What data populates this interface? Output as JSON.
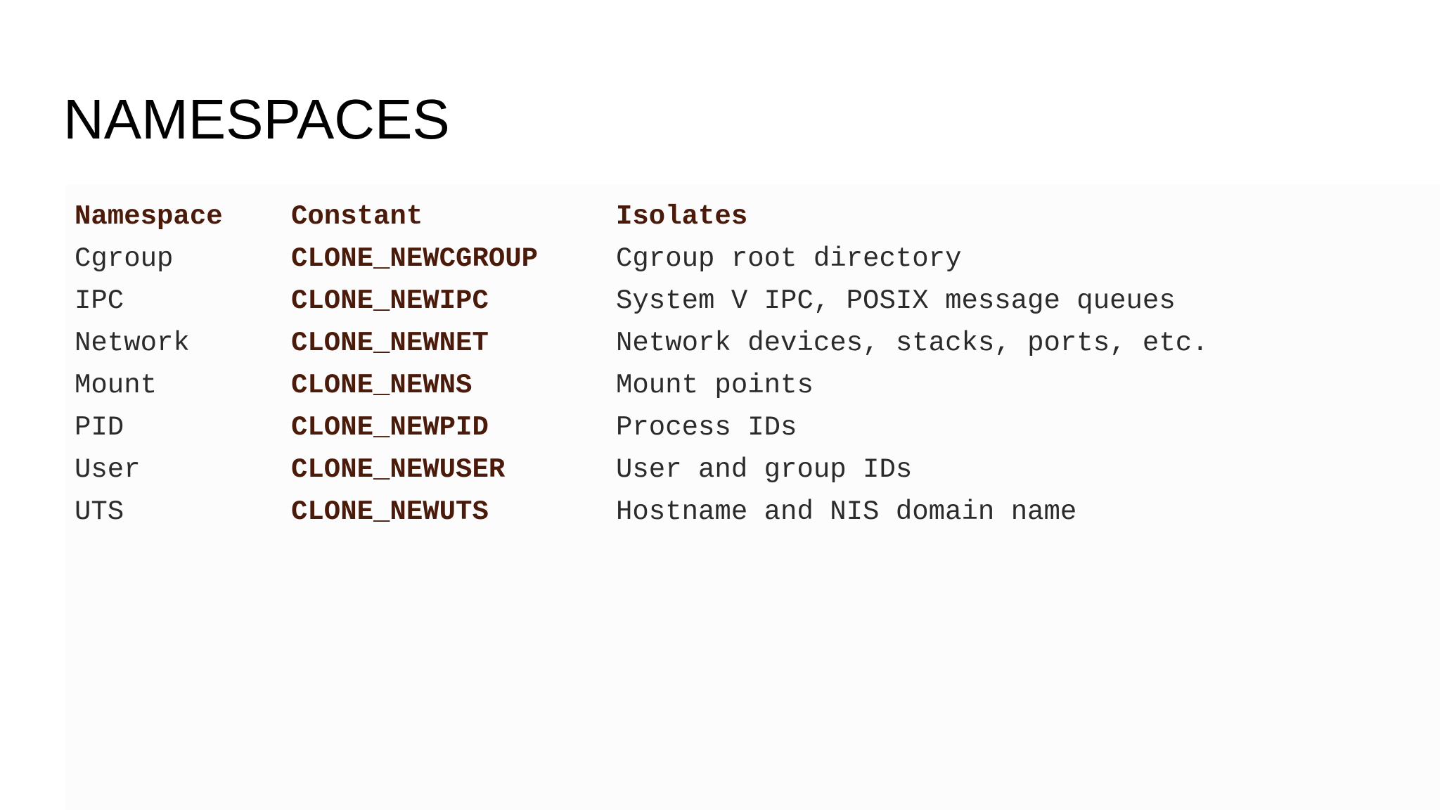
{
  "slide": {
    "title": "NAMESPACES"
  },
  "table": {
    "headers": {
      "namespace": "Namespace",
      "constant": "Constant",
      "isolates": "Isolates"
    },
    "rows": [
      {
        "namespace": "Cgroup",
        "constant": "CLONE_NEWCGROUP",
        "isolates": "Cgroup root directory"
      },
      {
        "namespace": "IPC",
        "constant": "CLONE_NEWIPC",
        "isolates": "System V IPC, POSIX message queues"
      },
      {
        "namespace": "Network",
        "constant": "CLONE_NEWNET",
        "isolates": "Network devices, stacks, ports, etc."
      },
      {
        "namespace": "Mount",
        "constant": "CLONE_NEWNS",
        "isolates": "Mount points"
      },
      {
        "namespace": "PID",
        "constant": "CLONE_NEWPID",
        "isolates": "Process IDs"
      },
      {
        "namespace": "User",
        "constant": "CLONE_NEWUSER",
        "isolates": "User and group IDs"
      },
      {
        "namespace": "UTS",
        "constant": "CLONE_NEWUTS",
        "isolates": "Hostname and NIS domain name"
      }
    ]
  },
  "colors": {
    "header_text": "#4a1a0a",
    "constant_text": "#4a1a0a",
    "body_text": "#2b2b2b",
    "title_text": "#000000",
    "background": "#ffffff"
  }
}
